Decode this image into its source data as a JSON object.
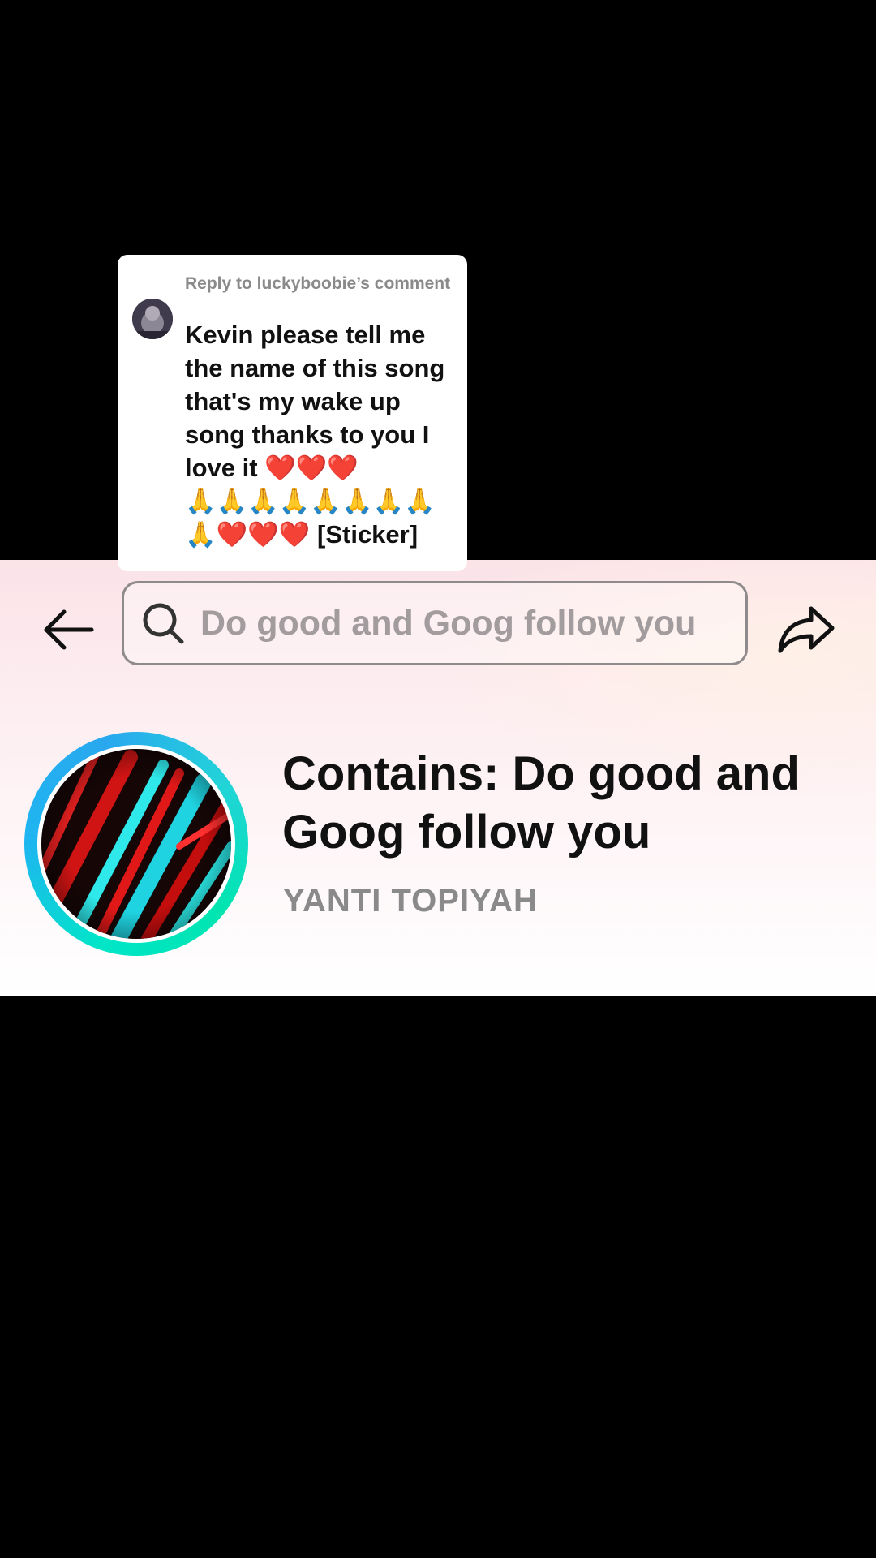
{
  "reply_comment": {
    "header": "Reply to luckyboobie’s comment",
    "body": "Kevin please tell me the name of this song that's my wake up song thanks to you I love it ❤️❤️❤️\n🙏🙏🙏🙏🙏🙏🙏🙏\n🙏❤️❤️❤️ [Sticker]"
  },
  "music_panel": {
    "search_value": "Do good and Goog follow you",
    "title": "Contains: Do good and Goog follow you",
    "artist": "YANTI TOPIYAH",
    "icons": {
      "back": "arrow-left-icon",
      "search": "search-icon",
      "share": "share-arrow-icon"
    },
    "colors": {
      "cover_ring_start": "#00e5c8",
      "cover_ring_end": "#29a8ef",
      "artist": "#8a8a8a",
      "search_text": "#a39c9e"
    }
  }
}
